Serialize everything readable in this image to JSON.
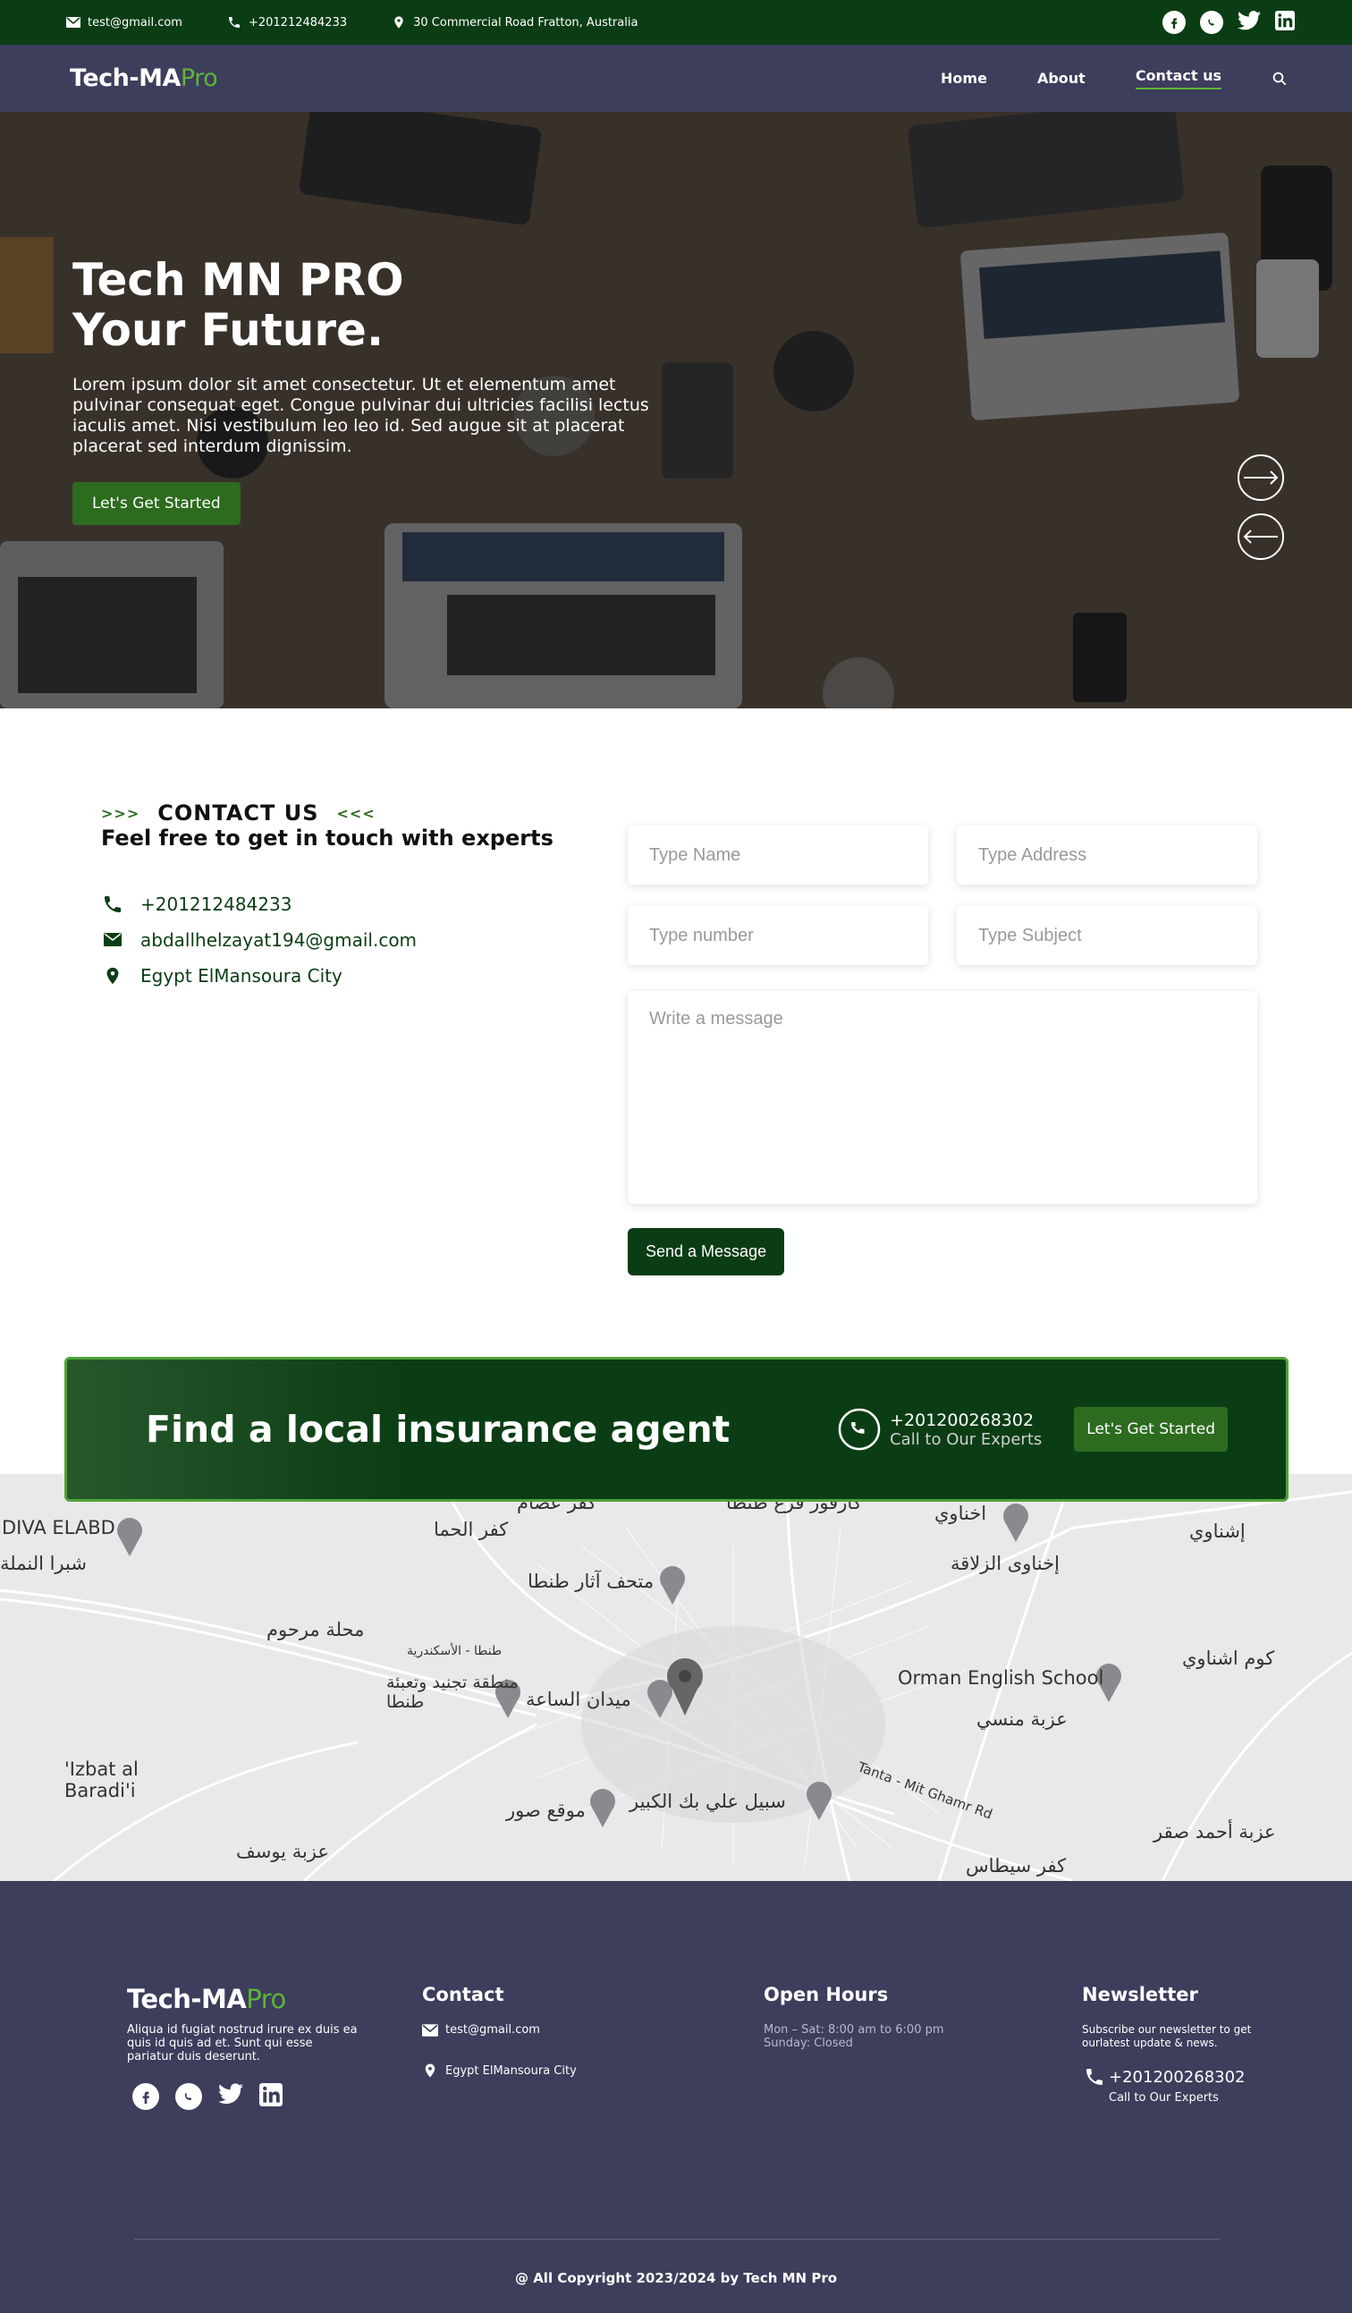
{
  "topbar": {
    "email": "test@gmail.com",
    "phone": "+201212484233",
    "address": "30 Commercial Road Fratton, Australia",
    "social_icons": [
      "facebook-icon",
      "whatsapp-icon",
      "twitter-icon",
      "linkedin-icon"
    ]
  },
  "nav": {
    "logo_main": "Tech-MA",
    "logo_accent": "Pro",
    "links": [
      "Home",
      "About",
      "Contact us"
    ],
    "active": "Contact us"
  },
  "hero": {
    "title_line1": "Tech MN PRO",
    "title_line2": "Your Future.",
    "body": "Lorem ipsum dolor sit amet consectetur. Ut et elementum amet pulvinar consequat eget. Congue pulvinar dui ultricies facilisi lectus iaculis amet. Nisi vestibulum leo leo id. Sed augue sit at placerat placerat sed interdum dignissim.",
    "cta": "Let's Get Started"
  },
  "contact": {
    "chev_left": ">>>",
    "label": "CONTACT US",
    "chev_right": "<<<",
    "heading": "Feel free to get in touch with experts",
    "phone": "+201212484233",
    "email": "abdallhelzayat194@gmail.com",
    "location": "Egypt ElMansoura City",
    "form": {
      "name_placeholder": "Type Name",
      "address_placeholder": "Type Address",
      "number_placeholder": "Type number",
      "subject_placeholder": "Type Subject",
      "message_placeholder": "Write a message",
      "send_label": "Send a Message"
    }
  },
  "banner": {
    "title": "Find a local insurance agent",
    "phone": "+201200268302",
    "phone_sub": "Call to Our Experts",
    "cta": "Let's Get Started"
  },
  "map": {
    "labels": [
      "كفر عصام",
      "كارفور فرع طنطا",
      "اخناوي",
      "DIVA ELABD",
      "كفر الحما",
      "إشناوي",
      "شبرا النملة",
      "متحف آثار طنطا",
      "إخناوى الزلاقة",
      "محلة مرحوم",
      "طنطا - الأسكندرية",
      "منطقة تجنيد وتعبئة طنطا",
      "ميدان الساعة",
      "Orman English School",
      "كوم اشناوي",
      "عزبة منسي",
      "'Izbat al Baradi'i",
      "موقع صور",
      "سبيل علي بك الكبير",
      "Tanta - Mit Ghamr Rd",
      "عزبة يوسف",
      "عزبة أحمد صقر",
      "كفر سيطاس"
    ]
  },
  "footer": {
    "logo_main": "Tech-MA",
    "logo_accent": "Pro",
    "about": "Aliqua id fugiat nostrud irure ex duis ea quis id quis ad et. Sunt qui esse pariatur duis deserunt.",
    "contact_title": "Contact",
    "contact_email": "test@gmail.com",
    "contact_location": "Egypt ElMansoura City",
    "hours_title": "Open Hours",
    "hours_line1": "Mon – Sat: 8:00 am to 6:00 pm",
    "hours_line2": "Sunday: Closed",
    "newsletter_title": "Newsletter",
    "newsletter_text": "Subscribe our newsletter to get ourlatest update & news.",
    "newsletter_phone": "+201200268302",
    "newsletter_phone_sub": "Call to Our Experts",
    "copyright": "@ All Copyright 2023/2024 by Tech MN Pro"
  },
  "colors": {
    "dark_green": "#0b3d14",
    "accent_green": "#2d6b1f",
    "navy": "#3d3d5c"
  }
}
